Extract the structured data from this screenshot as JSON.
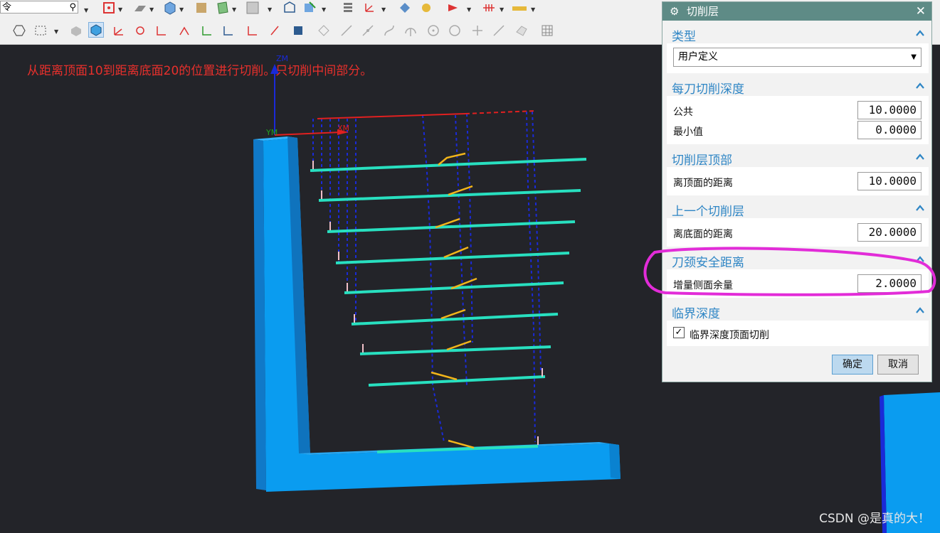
{
  "toolbar": {
    "command_box_text": "令",
    "row1_icons": [
      "search-icon",
      "snap-icon",
      "extrude-icon",
      "box-icon",
      "sheet-icon",
      "face-icon",
      "color-icon",
      "view-icon",
      "section-icon",
      "layer-icon",
      "csys-icon",
      "move-icon",
      "measure-icon",
      "grid-icon",
      "ruler-icon"
    ],
    "row2_icons": [
      "hexagon-icon",
      "rect-select-icon",
      "shaded-icon",
      "shaded-edges-icon",
      "csys-icon",
      "wcs-icon",
      "datum-icon",
      "line-icon",
      "arc-icon",
      "spline-icon",
      "point-icon",
      "circle-icon",
      "cross-icon",
      "plane-icon",
      "grid-icon"
    ]
  },
  "viewport": {
    "hint_text": "从距离顶面10到距离底面20的位置进行切削。只切削中间部分。",
    "axis_labels": {
      "zm": "ZM",
      "xm": "XM",
      "ym": "YM"
    },
    "watermark": "CSDN @是真的大！"
  },
  "dialog": {
    "title": "切削层",
    "close_label": "✕",
    "sections": {
      "type": {
        "title": "类型",
        "selected": "用户定义"
      },
      "depth_per_cut": {
        "title": "每刀切削深度",
        "common_label": "公共",
        "common_value": "10.0000",
        "min_label": "最小值",
        "min_value": "0.0000"
      },
      "top": {
        "title": "切削层顶部",
        "label": "离顶面的距离",
        "value": "10.0000"
      },
      "last": {
        "title": "上一个切削层",
        "label": "离底面的距离",
        "value": "20.0000"
      },
      "neck": {
        "title": "刀颈安全距离",
        "label": "增量侧面余量",
        "value": "2.0000"
      },
      "critical": {
        "title": "临界深度",
        "checkbox_label": "临界深度顶面切削",
        "checked": true
      }
    },
    "ok_label": "确定",
    "cancel_label": "取消"
  },
  "colors": {
    "accent": "#2f86c5",
    "title_bar": "#5e8b86",
    "part": "#0a9cf0",
    "toolpath": "#28e0c0",
    "rapid": "#1a2ad8",
    "lead": "#f2b51a",
    "annotation": "#e22cd8",
    "hint": "#e8302c"
  }
}
